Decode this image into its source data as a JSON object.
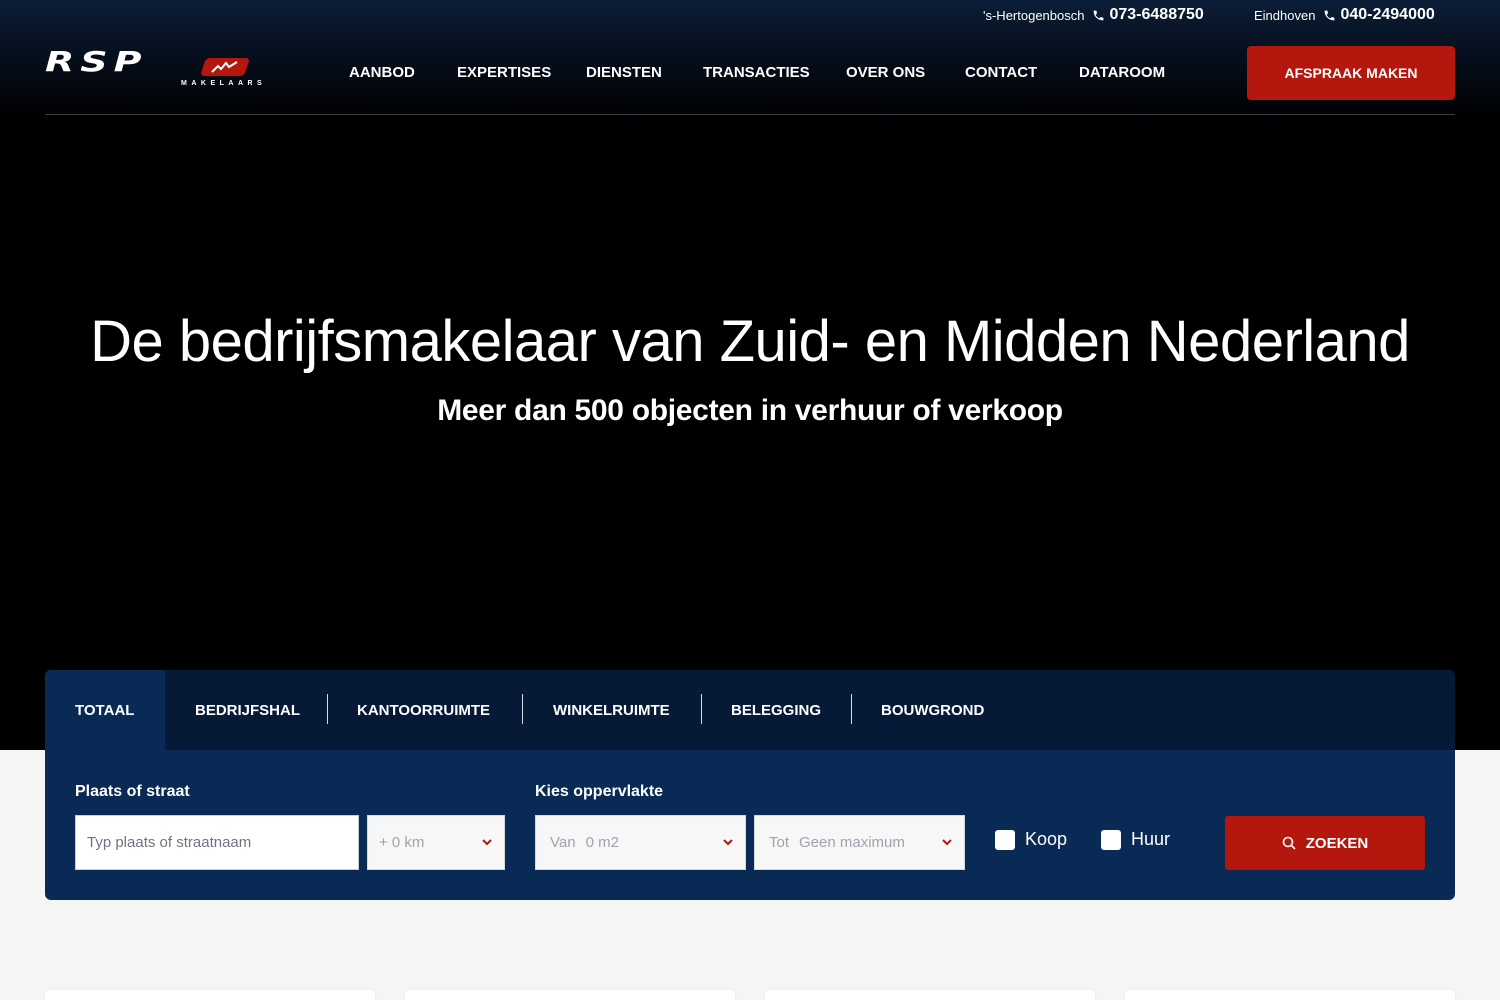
{
  "contacts": [
    {
      "city": "'s-Hertogenbosch",
      "phone": "073-6488750"
    },
    {
      "city": "Eindhoven",
      "phone": "040-2494000"
    }
  ],
  "logo": {
    "text": "RSP",
    "subtext": "MAKELAARS"
  },
  "nav": [
    "AANBOD",
    "EXPERTISES",
    "DIENSTEN",
    "TRANSACTIES",
    "OVER ONS",
    "CONTACT",
    "DATAROOM"
  ],
  "cta_label": "AFSPRAAK MAKEN",
  "hero": {
    "title": "De bedrijfsmakelaar van Zuid- en Midden Nederland",
    "subtitle": "Meer dan 500 objecten in verhuur of verkoop"
  },
  "search": {
    "tabs": [
      "TOTAAL",
      "BEDRIJFSHAL",
      "KANTOORRUIMTE",
      "WINKELRUIMTE",
      "BELEGGING",
      "BOUWGROND"
    ],
    "active_tab": "TOTAAL",
    "location_label": "Plaats of straat",
    "location_placeholder": "Typ plaats of straatnaam",
    "radius_value": "+ 0 km",
    "area_label": "Kies oppervlakte",
    "area_from_prefix": "Van",
    "area_from_value": "0 m2",
    "area_to_prefix": "Tot",
    "area_to_value": "Geen maximum",
    "checkbox_koop": "Koop",
    "checkbox_huur": "Huur",
    "button_label": "ZOEKEN"
  },
  "colors": {
    "accent": "#b3170e",
    "panel": "#0a2a56",
    "tabbar": "#061a38"
  }
}
